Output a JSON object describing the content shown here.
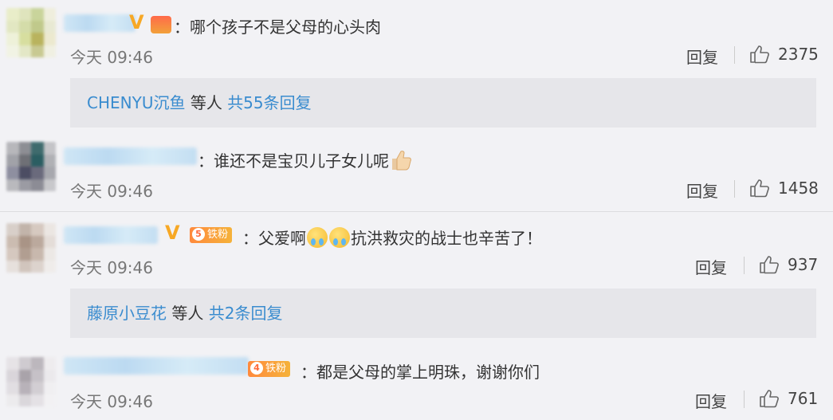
{
  "colors": {
    "link": "#3a8ccf",
    "badge_gold": "#f7a825",
    "fan_badge": "#ff8a3d"
  },
  "comments": [
    {
      "text": "：哪个孩子不是父母的心头肉",
      "time": "今天 09:46",
      "reply_label": "回复",
      "like_count": "2375",
      "badges": [
        "v-badge-icon",
        "crown-badge-icon"
      ],
      "sub_reply": {
        "user": "CHENYU沉鱼",
        "others": " 等人 ",
        "count_label": "共55条回复"
      }
    },
    {
      "text": "：谁还不是宝贝儿子女儿呢",
      "emoji": [
        "thumbs-up-emoji"
      ],
      "time": "今天 09:46",
      "reply_label": "回复",
      "like_count": "1458"
    },
    {
      "text_before": "：父爱啊",
      "emoji": [
        "crying-emoji",
        "crying-emoji"
      ],
      "text_after": "抗洪救灾的战士也辛苦了！",
      "time": "今天 09:46",
      "reply_label": "回复",
      "like_count": "937",
      "badges": [
        "v-badge-icon",
        "fan-badge-icon"
      ],
      "fan_badge": {
        "level": "5",
        "label": "铁粉"
      },
      "sub_reply": {
        "user": "藤原小豆花",
        "others": " 等人 ",
        "count_label": "共2条回复"
      }
    },
    {
      "text": "：都是父母的掌上明珠，谢谢你们",
      "time": "今天 09:46",
      "reply_label": "回复",
      "like_count": "761",
      "badges": [
        "fan-badge-icon"
      ],
      "fan_badge": {
        "level": "4",
        "label": "铁粉"
      }
    }
  ]
}
